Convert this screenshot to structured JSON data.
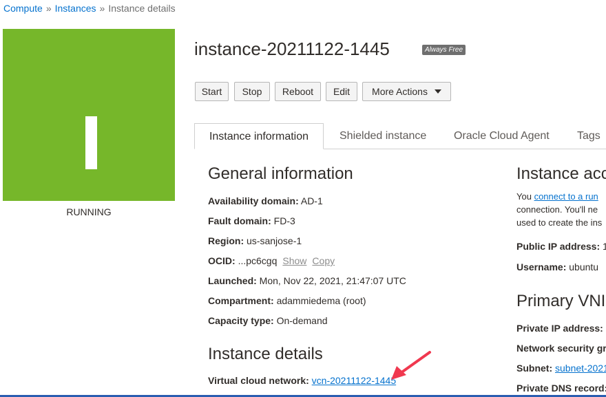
{
  "breadcrumb": {
    "items": [
      "Compute",
      "Instances"
    ],
    "current": "Instance details",
    "sep": "»"
  },
  "tile": {
    "letter": "I",
    "color": "#76b72a",
    "status": "RUNNING"
  },
  "instance": {
    "title": "instance-20211122-1445",
    "badge": "Always Free"
  },
  "actions": {
    "start": "Start",
    "stop": "Stop",
    "reboot": "Reboot",
    "edit": "Edit",
    "more": "More Actions"
  },
  "tabs": [
    "Instance information",
    "Shielded instance",
    "Oracle Cloud Agent",
    "Tags"
  ],
  "general": {
    "heading": "General information",
    "availability_domain": {
      "label": "Availability domain:",
      "value": "AD-1"
    },
    "fault_domain": {
      "label": "Fault domain:",
      "value": "FD-3"
    },
    "region": {
      "label": "Region:",
      "value": "us-sanjose-1"
    },
    "ocid": {
      "label": "OCID:",
      "value": "...pc6cgq",
      "show": "Show",
      "copy": "Copy"
    },
    "launched": {
      "label": "Launched:",
      "value": "Mon, Nov 22, 2021, 21:47:07 UTC"
    },
    "compartment": {
      "label": "Compartment:",
      "value": "adammiedema (root)"
    },
    "capacity_type": {
      "label": "Capacity type:",
      "value": "On-demand"
    }
  },
  "details": {
    "heading": "Instance details",
    "vcn": {
      "label": "Virtual cloud network:",
      "value": "vcn-20211122-1445"
    }
  },
  "access": {
    "heading": "Instance acc",
    "line1_prefix": "You ",
    "line1_link": "connect to a run",
    "line2": "connection. You'll ne",
    "line3": "used to create the ins",
    "public_ip": {
      "label": "Public IP address:",
      "value": "1"
    },
    "username": {
      "label": "Username:",
      "value": "ubuntu"
    }
  },
  "vnic": {
    "heading": "Primary VNIC",
    "private_ip": {
      "label": "Private IP address:"
    },
    "nsg": {
      "label": "Network security gr"
    },
    "subnet": {
      "label": "Subnet:",
      "value": "subnet-2021"
    },
    "dns": {
      "label": "Private DNS record:"
    }
  },
  "colors": {
    "accent": "#0572ce",
    "arrow": "#f0384f",
    "running": "#76b72a"
  }
}
